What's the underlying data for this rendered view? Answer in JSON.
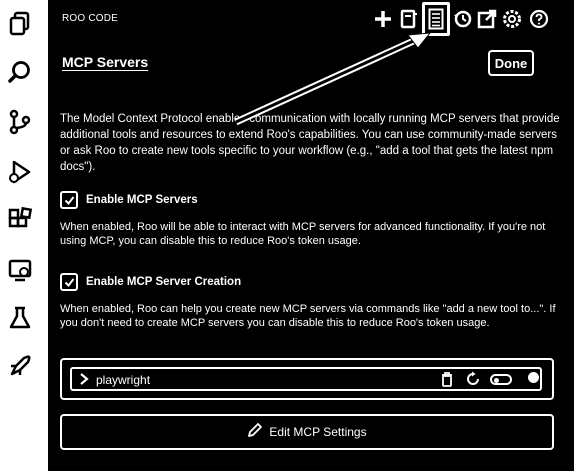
{
  "header": {
    "app_title": "ROO CODE"
  },
  "toolbar": {
    "items": [
      {
        "icon": "plus-icon"
      },
      {
        "icon": "prompts-icon"
      },
      {
        "icon": "mcp-server-icon",
        "active": true
      },
      {
        "icon": "history-icon"
      },
      {
        "icon": "popout-icon"
      },
      {
        "icon": "settings-gear-icon"
      },
      {
        "icon": "help-icon"
      }
    ]
  },
  "activity_bar": {
    "icons": [
      "explorer-icon",
      "search-icon",
      "source-control-icon",
      "run-debug-icon",
      "extensions-icon",
      "remote-explorer-icon",
      "testing-icon",
      "roo-rocket-icon"
    ]
  },
  "page": {
    "title": "MCP Servers",
    "done_label": "Done",
    "intro": "The Model Context Protocol enables communication with locally running MCP servers that provide additional tools and resources to extend Roo's capabilities. You can use community-made servers or ask Roo to create new tools specific to your workflow (e.g., \"add a tool that gets the latest npm docs\")."
  },
  "settings": {
    "enable_mcp": {
      "label": "Enable MCP Servers",
      "checked": true,
      "description": "When enabled, Roo will be able to interact with MCP servers for advanced functionality. If you're not using MCP, you can disable this to reduce Roo's token usage."
    },
    "enable_creation": {
      "label": "Enable MCP Server Creation",
      "checked": true,
      "description": "When enabled, Roo can help you create new MCP servers via commands like \"add a new tool to...\". If you don't need to create MCP servers you can disable this to reduce Roo's token usage."
    }
  },
  "servers": [
    {
      "name": "playwright",
      "enabled": false
    }
  ],
  "edit_settings_label": "Edit MCP Settings"
}
